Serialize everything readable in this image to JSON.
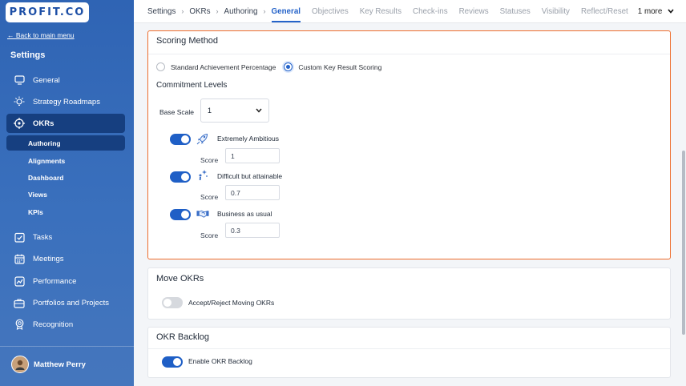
{
  "brand": {
    "logo": "PROFIT.CO"
  },
  "sidebar": {
    "back_link": "← Back to main menu",
    "title": "Settings",
    "items": [
      {
        "label": "General",
        "icon": "monitor-icon"
      },
      {
        "label": "Strategy Roadmaps",
        "icon": "bulb-icon"
      },
      {
        "label": "OKRs",
        "icon": "target-icon",
        "active": true
      },
      {
        "label": "Tasks",
        "icon": "checkbox-icon"
      },
      {
        "label": "Meetings",
        "icon": "calendar-icon"
      },
      {
        "label": "Performance",
        "icon": "trend-icon"
      },
      {
        "label": "Portfolios and Projects",
        "icon": "briefcase-icon"
      },
      {
        "label": "Recognition",
        "icon": "award-icon"
      }
    ],
    "sub_items": [
      {
        "label": "Authoring",
        "active": true
      },
      {
        "label": "Alignments"
      },
      {
        "label": "Dashboard"
      },
      {
        "label": "Views"
      },
      {
        "label": "KPIs"
      }
    ],
    "user": {
      "name": "Matthew Perry"
    }
  },
  "topbar": {
    "breadcrumb": [
      "Settings",
      "OKRs",
      "Authoring"
    ],
    "separator": "›",
    "tabs": [
      "General",
      "Objectives",
      "Key Results",
      "Check-ins",
      "Reviews",
      "Statuses",
      "Visibility",
      "Reflect/Reset"
    ],
    "active_tab": "General",
    "more_label": "1 more"
  },
  "scoring": {
    "title": "Scoring Method",
    "options": [
      "Standard Achievement Percentage",
      "Custom Key Result Scoring"
    ],
    "selected_option": "Custom Key Result Scoring",
    "commitment_title": "Commitment Levels",
    "base_scale_label": "Base Scale",
    "base_scale_value": "1",
    "score_label": "Score",
    "levels": [
      {
        "name": "Extremely Ambitious",
        "score": "1",
        "enabled": true,
        "icon": "rocket-icon"
      },
      {
        "name": "Difficult but attainable",
        "score": "0.7",
        "enabled": true,
        "icon": "sparkle-person-icon"
      },
      {
        "name": "Business as usual",
        "score": "0.3",
        "enabled": true,
        "icon": "handshake-icon"
      }
    ]
  },
  "move_okrs": {
    "title": "Move OKRs",
    "option_label": "Accept/Reject Moving OKRs",
    "enabled": false
  },
  "okr_backlog": {
    "title": "OKR Backlog",
    "option_label": "Enable OKR Backlog",
    "enabled": true
  },
  "colors": {
    "sidebar": "#3a70bd",
    "accent": "#2563c9",
    "highlight_border": "#ee6d2d",
    "active_nav": "#163f80"
  }
}
